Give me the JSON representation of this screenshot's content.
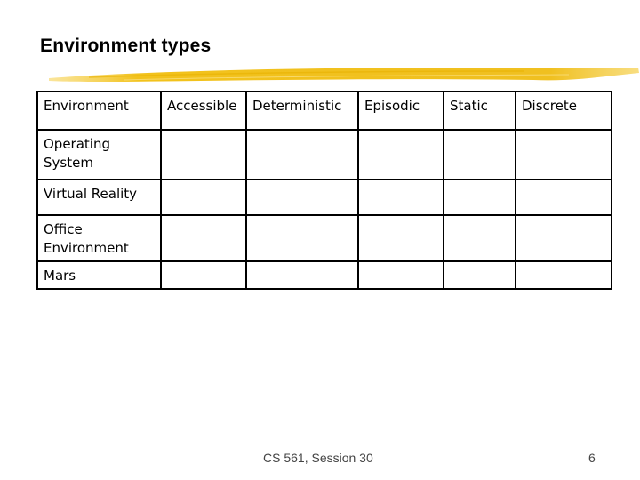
{
  "slide": {
    "title": "Environment types",
    "table": {
      "headers": [
        "Environment",
        "Accessible",
        "Deterministic",
        "Episodic",
        "Static",
        "Discrete"
      ],
      "rows": [
        [
          "Operating System",
          "",
          "",
          "",
          "",
          ""
        ],
        [
          "Virtual Reality",
          "",
          "",
          "",
          "",
          ""
        ],
        [
          "Office Environment",
          "",
          "",
          "",
          "",
          ""
        ],
        [
          "Mars",
          "",
          "",
          "",
          "",
          ""
        ]
      ]
    },
    "footer": {
      "course": "CS 561,  Session 30",
      "page_number": "6"
    },
    "accent_color": "#f2c21c"
  }
}
